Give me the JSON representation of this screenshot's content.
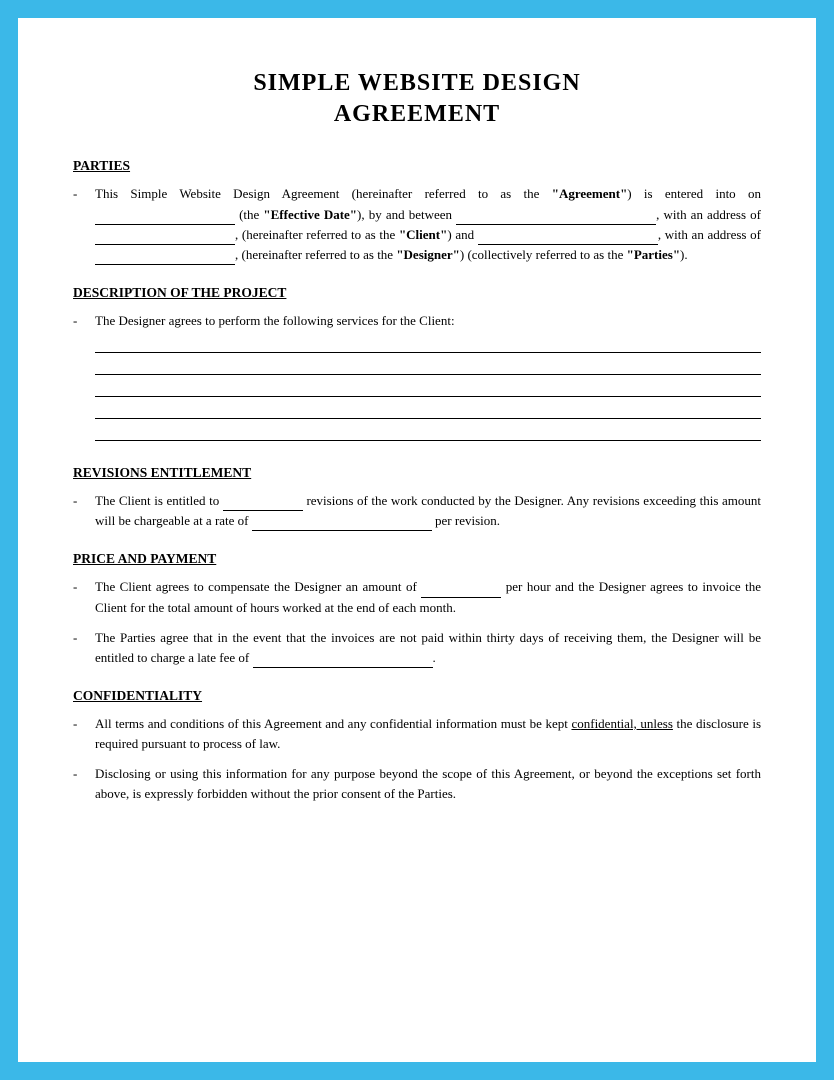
{
  "document": {
    "title_line1": "SIMPLE WEBSITE DESIGN",
    "title_line2": "AGREEMENT",
    "sections": {
      "parties": {
        "heading": "PARTIES",
        "bullet1": {
          "text_1": "This Simple Website Design Agreement (hereinafter referred to as the ",
          "bold_1": "“Agreement”",
          "text_2": ") is entered into on",
          "blank_1": "",
          "text_3": "(the ",
          "bold_2": "“Effective Date”",
          "text_4": "), by and between",
          "blank_2": "",
          "text_5": ", with an address of",
          "blank_3": "",
          "text_6": ", (hereinafter referred to as the ",
          "bold_3": "“Client”",
          "text_7": ") and",
          "blank_4": "",
          "text_8": ", with an address of",
          "blank_5": "",
          "text_9": ", (hereinafter referred to as the ",
          "bold_4": "“Designer”",
          "text_10": ") (collectively referred to as the ",
          "bold_5": "“Parties”",
          "text_11": ")."
        }
      },
      "description": {
        "heading": "DESCRIPTION OF THE PROJECT",
        "bullet1_text1": "The Designer agrees to perform the following services for the Client:"
      },
      "revisions": {
        "heading": "REVISIONS ENTITLEMENT",
        "bullet1_text1": "The Client is entitled to",
        "bullet1_blank1": "",
        "bullet1_text2": "revisions of the work conducted by the Designer. Any revisions exceeding this amount will be chargeable at a rate of",
        "bullet1_blank2": "",
        "bullet1_text3": "per revision."
      },
      "price": {
        "heading": "PRICE AND PAYMENT",
        "bullet1_text1": "The Client agrees to compensate the Designer an amount of",
        "bullet1_blank1": "",
        "bullet1_text2": "per hour and the Designer agrees to invoice the Client for the total amount of hours worked at the end of each month.",
        "bullet2_text1": "The Parties agree that in the event that the invoices are not paid within thirty days of receiving them, the Designer will be entitled to charge a late fee of",
        "bullet2_blank1": "",
        "bullet2_text2": "."
      },
      "confidentiality": {
        "heading": "CONFIDENTIALITY",
        "bullet1_text1": "All terms and conditions of this Agreement and any confidential information must be kept ",
        "bullet1_underline": "confidential, unless",
        "bullet1_text2": " the disclosure is required pursuant to process of law.",
        "bullet2_text1": "Disclosing or using this information for any purpose beyond the scope of this Agreement, or beyond the exceptions set forth above, is expressly forbidden without the prior consent of the Parties."
      }
    }
  }
}
